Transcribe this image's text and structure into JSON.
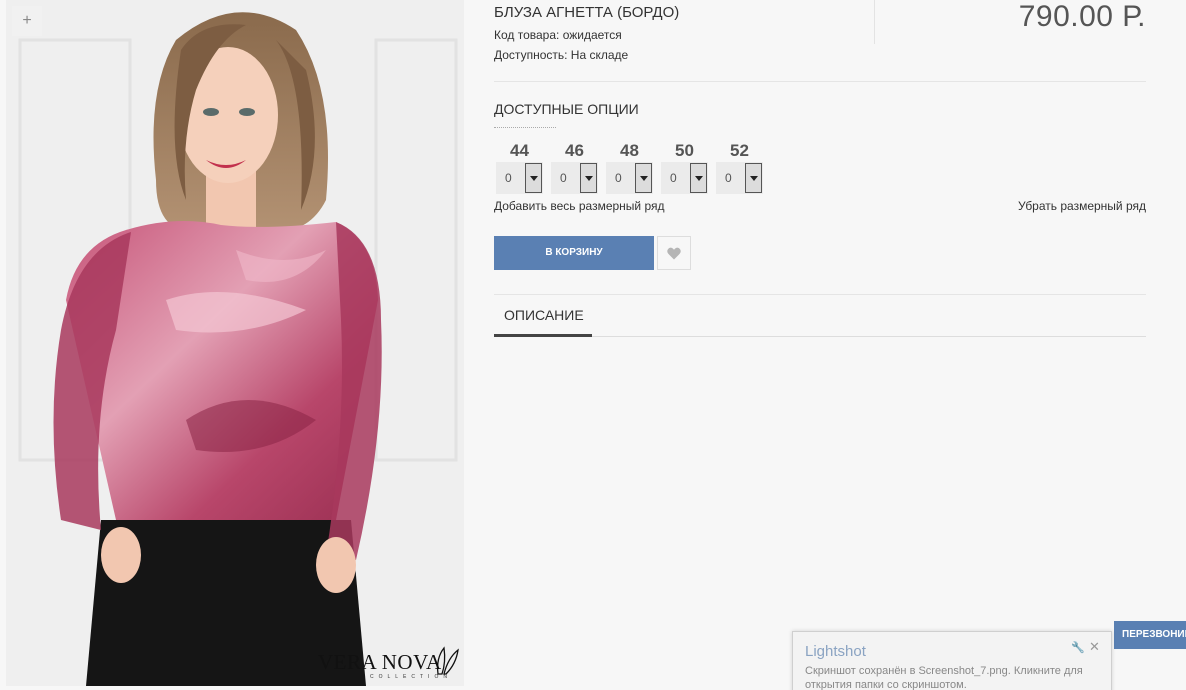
{
  "gallery": {
    "zoom_icon": "plus-icon",
    "zoom_label": "+",
    "logo_text": "VERA NOVA",
    "logo_sub": "COLLECTION"
  },
  "product": {
    "title": "БЛУЗА АГНЕТТА (БОРДО)",
    "code_line": "Код товара: ожидается",
    "availability_line": "Доступность: На складе",
    "price": "790.00 Р."
  },
  "options": {
    "title": "ДОСТУПНЫЕ ОПЦИИ",
    "sizes": [
      {
        "label": "44",
        "qty": "0"
      },
      {
        "label": "46",
        "qty": "0"
      },
      {
        "label": "48",
        "qty": "0"
      },
      {
        "label": "50",
        "qty": "0"
      },
      {
        "label": "52",
        "qty": "0"
      }
    ],
    "add_row": "Добавить весь размерный ряд",
    "remove_row": "Убрать размерный ряд"
  },
  "actions": {
    "cart_label": "В КОРЗИНУ",
    "wishlist_icon": "heart-icon"
  },
  "tabs": {
    "description": "ОПИСАНИЕ"
  },
  "callback": {
    "label": "ПЕРЕЗВОНИМ"
  },
  "toast": {
    "title": "Lightshot",
    "body": "Скриншот сохранён в Screenshot_7.png. Кликните для открытия папки со скриншотом.",
    "close": "✕",
    "settings_icon": "wrench-icon"
  },
  "colors": {
    "accent": "#5a80b3",
    "blouse": "#b23a5e"
  }
}
